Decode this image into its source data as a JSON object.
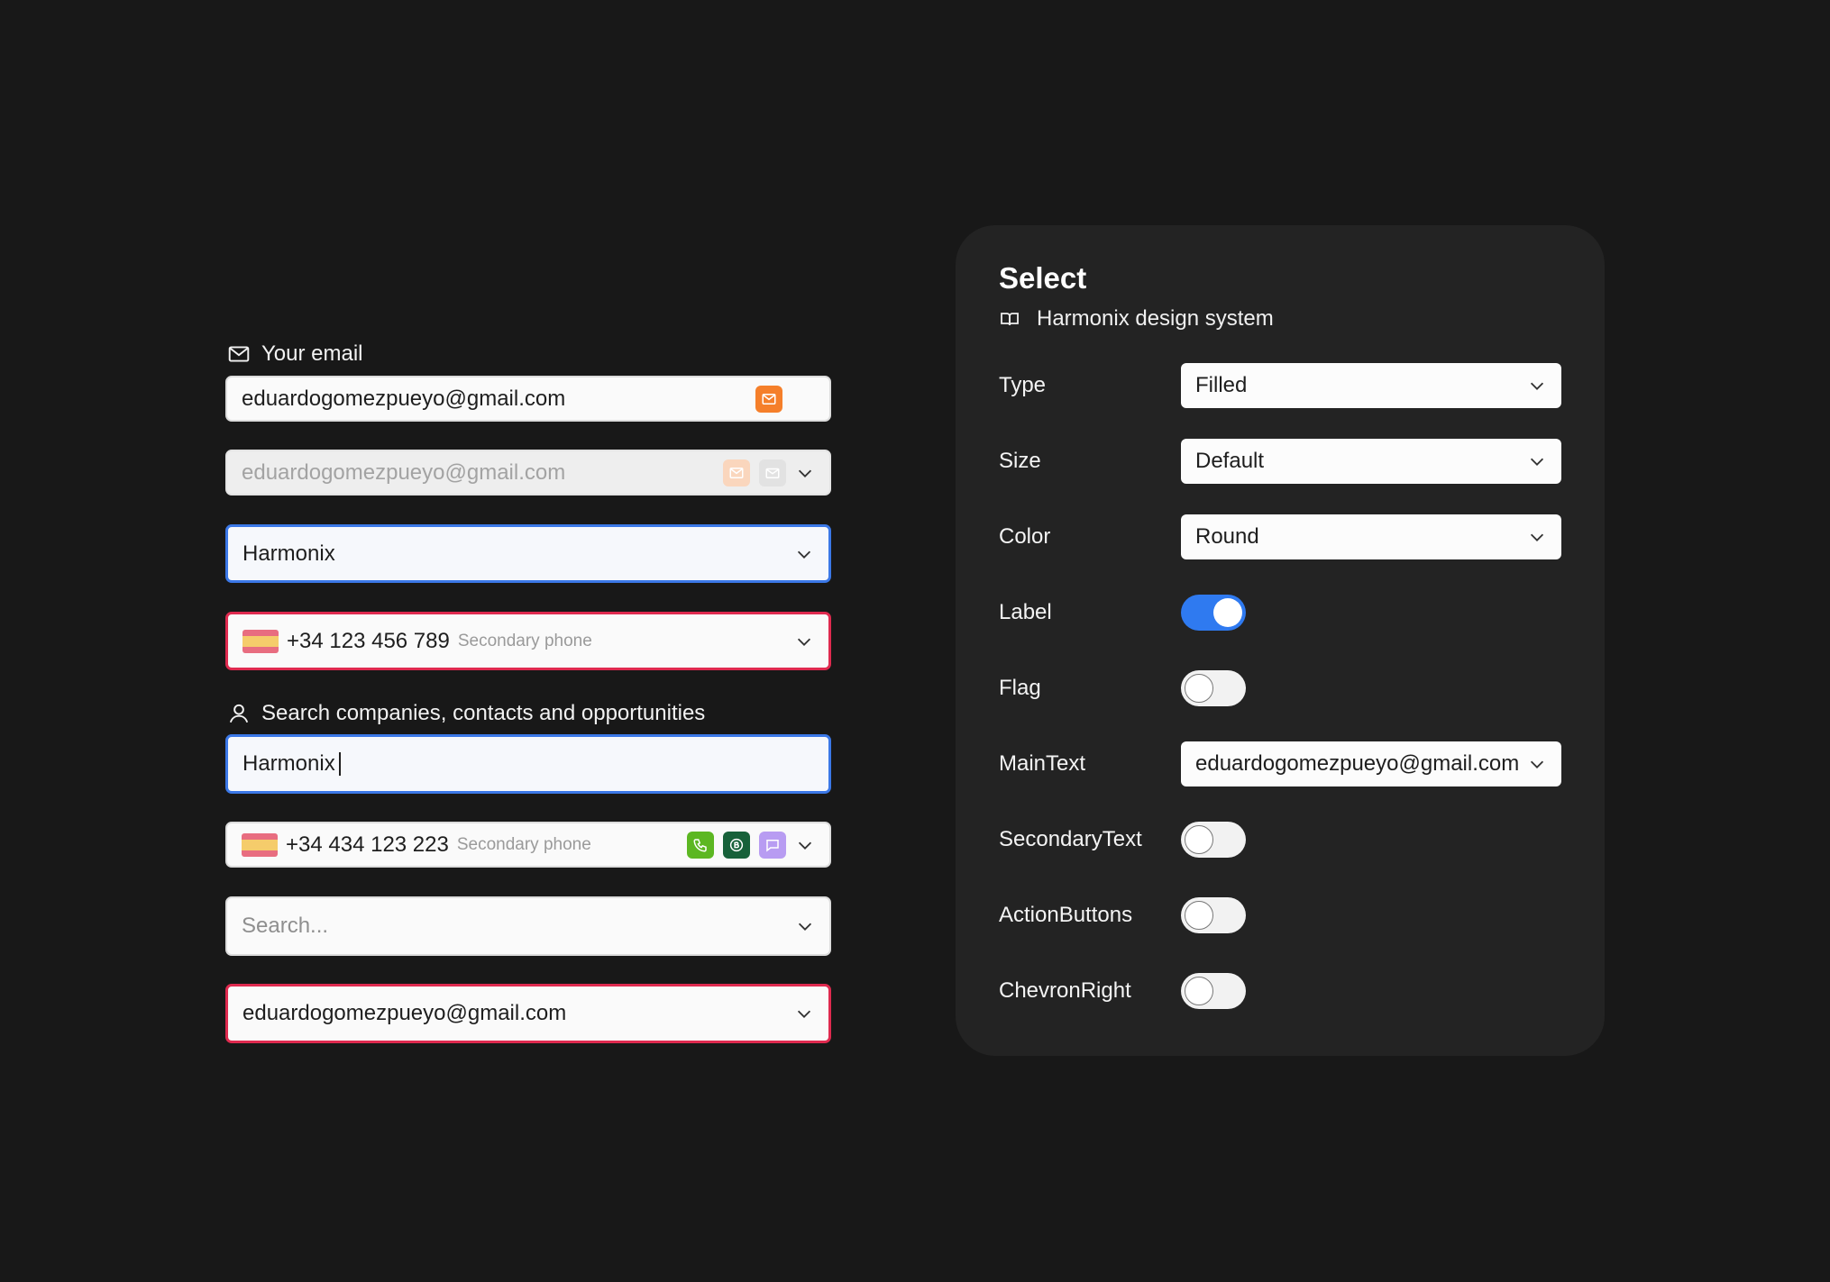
{
  "examples": {
    "email_label": "Your email",
    "email_value": "eduardogomezpueyo@gmail.com",
    "disabled_value": "eduardogomezpueyo@gmail.com",
    "harmonix_value": "Harmonix",
    "phone1_value": "+34 123 456 789",
    "phone1_secondary": "Secondary phone",
    "search_label": "Search companies, contacts and opportunities",
    "typing_value": "Harmonix",
    "phone2_value": "+34 434 123 223",
    "phone2_secondary": "Secondary phone",
    "search_placeholder": "Search...",
    "error_email_value": "eduardogomezpueyo@gmail.com"
  },
  "panel": {
    "title": "Select",
    "subtitle": "Harmonix design system",
    "props": {
      "type": {
        "label": "Type",
        "value": "Filled"
      },
      "size": {
        "label": "Size",
        "value": "Default"
      },
      "color": {
        "label": "Color",
        "value": "Round"
      },
      "label": {
        "label": "Label",
        "on": true
      },
      "flag": {
        "label": "Flag",
        "on": false
      },
      "maintext": {
        "label": "MainText",
        "value": "eduardogomezpueyo@gmail.com"
      },
      "secondarytext": {
        "label": "SecondaryText",
        "on": false
      },
      "actionbuttons": {
        "label": "ActionButtons",
        "on": false
      },
      "chevronright": {
        "label": "ChevronRight",
        "on": false
      }
    }
  },
  "colors": {
    "background": "#181818",
    "panel": "#232323",
    "accent_blue": "#3b78e7",
    "error_red": "#df2a4f",
    "email_action": "#f57f2a",
    "phone_action": "#5cb722",
    "whatsapp_action": "#17613a",
    "message_action": "#b89cf2"
  },
  "icons": [
    "mail-icon",
    "user-icon",
    "book-icon",
    "chevron-down-icon",
    "phone-icon",
    "whatsapp-icon",
    "message-icon",
    "spain-flag"
  ]
}
